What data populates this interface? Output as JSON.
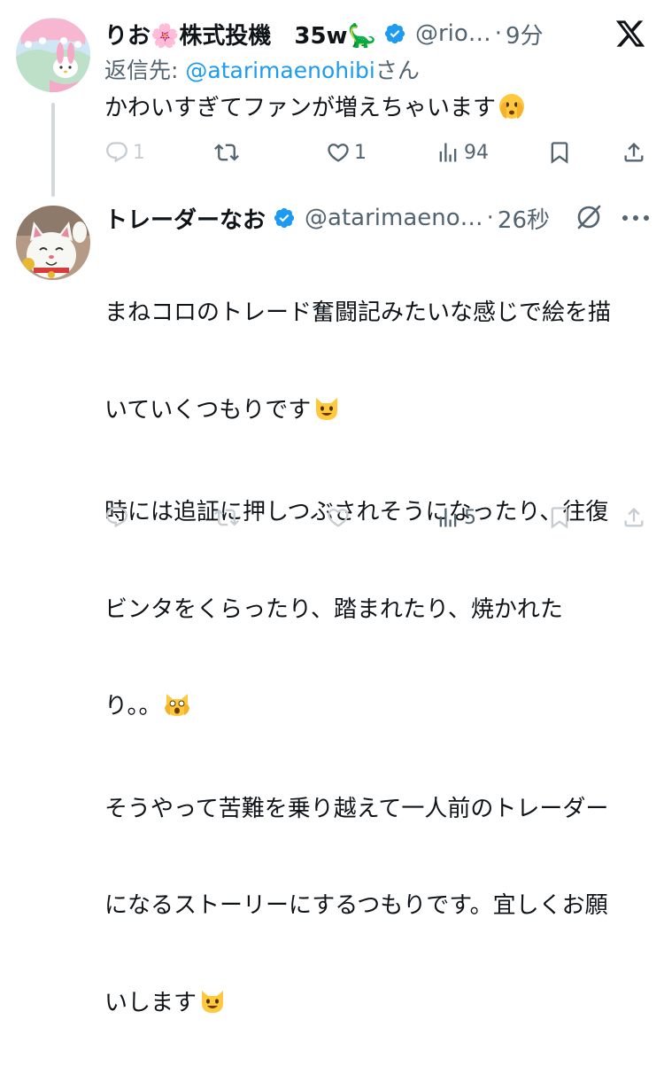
{
  "tweets": [
    {
      "display_name": "りお🌸株式投機　35w🦕",
      "handle": "@rio…",
      "separator": "·",
      "time": "9分",
      "reply_to_prefix": "返信先: ",
      "reply_to_mention": "@atarimaenohibi",
      "reply_to_suffix": "さん",
      "text": "かわいすぎてファンが増えちゃいます",
      "emojis": [
        "🫣"
      ],
      "actions": {
        "reply": "1",
        "repost": "",
        "like": "1",
        "views": "94"
      }
    },
    {
      "display_name": "トレーダーなお",
      "handle": "@atarimaeno…",
      "separator": "·",
      "time": "26秒",
      "lines": [
        "まねコロのトレード奮闘記みたいな感じで絵を描",
        "いていくつもりです",
        "時には追証に押しつぶされそうになったり、往復",
        "ビンタをくらったり、踏まれたり、焼かれた",
        "り。。",
        "そうやって苦難を乗り越えて一人前のトレーダー",
        "になるストーリーにするつもりです。宜しくお願",
        "いします"
      ],
      "emojis": [
        "😺",
        "🙀",
        "😺"
      ],
      "actions": {
        "reply": "",
        "repost": "",
        "like": "",
        "views": "5"
      }
    }
  ],
  "icons": {
    "close": "x-logo-icon",
    "grok": "grok-icon",
    "more": "more-dots-icon",
    "verified": "verified-badge-icon"
  },
  "colors": {
    "text": "#0f1419",
    "secondary": "#536471",
    "accent": "#1d9bf0",
    "thread_line": "#cfd9de"
  }
}
